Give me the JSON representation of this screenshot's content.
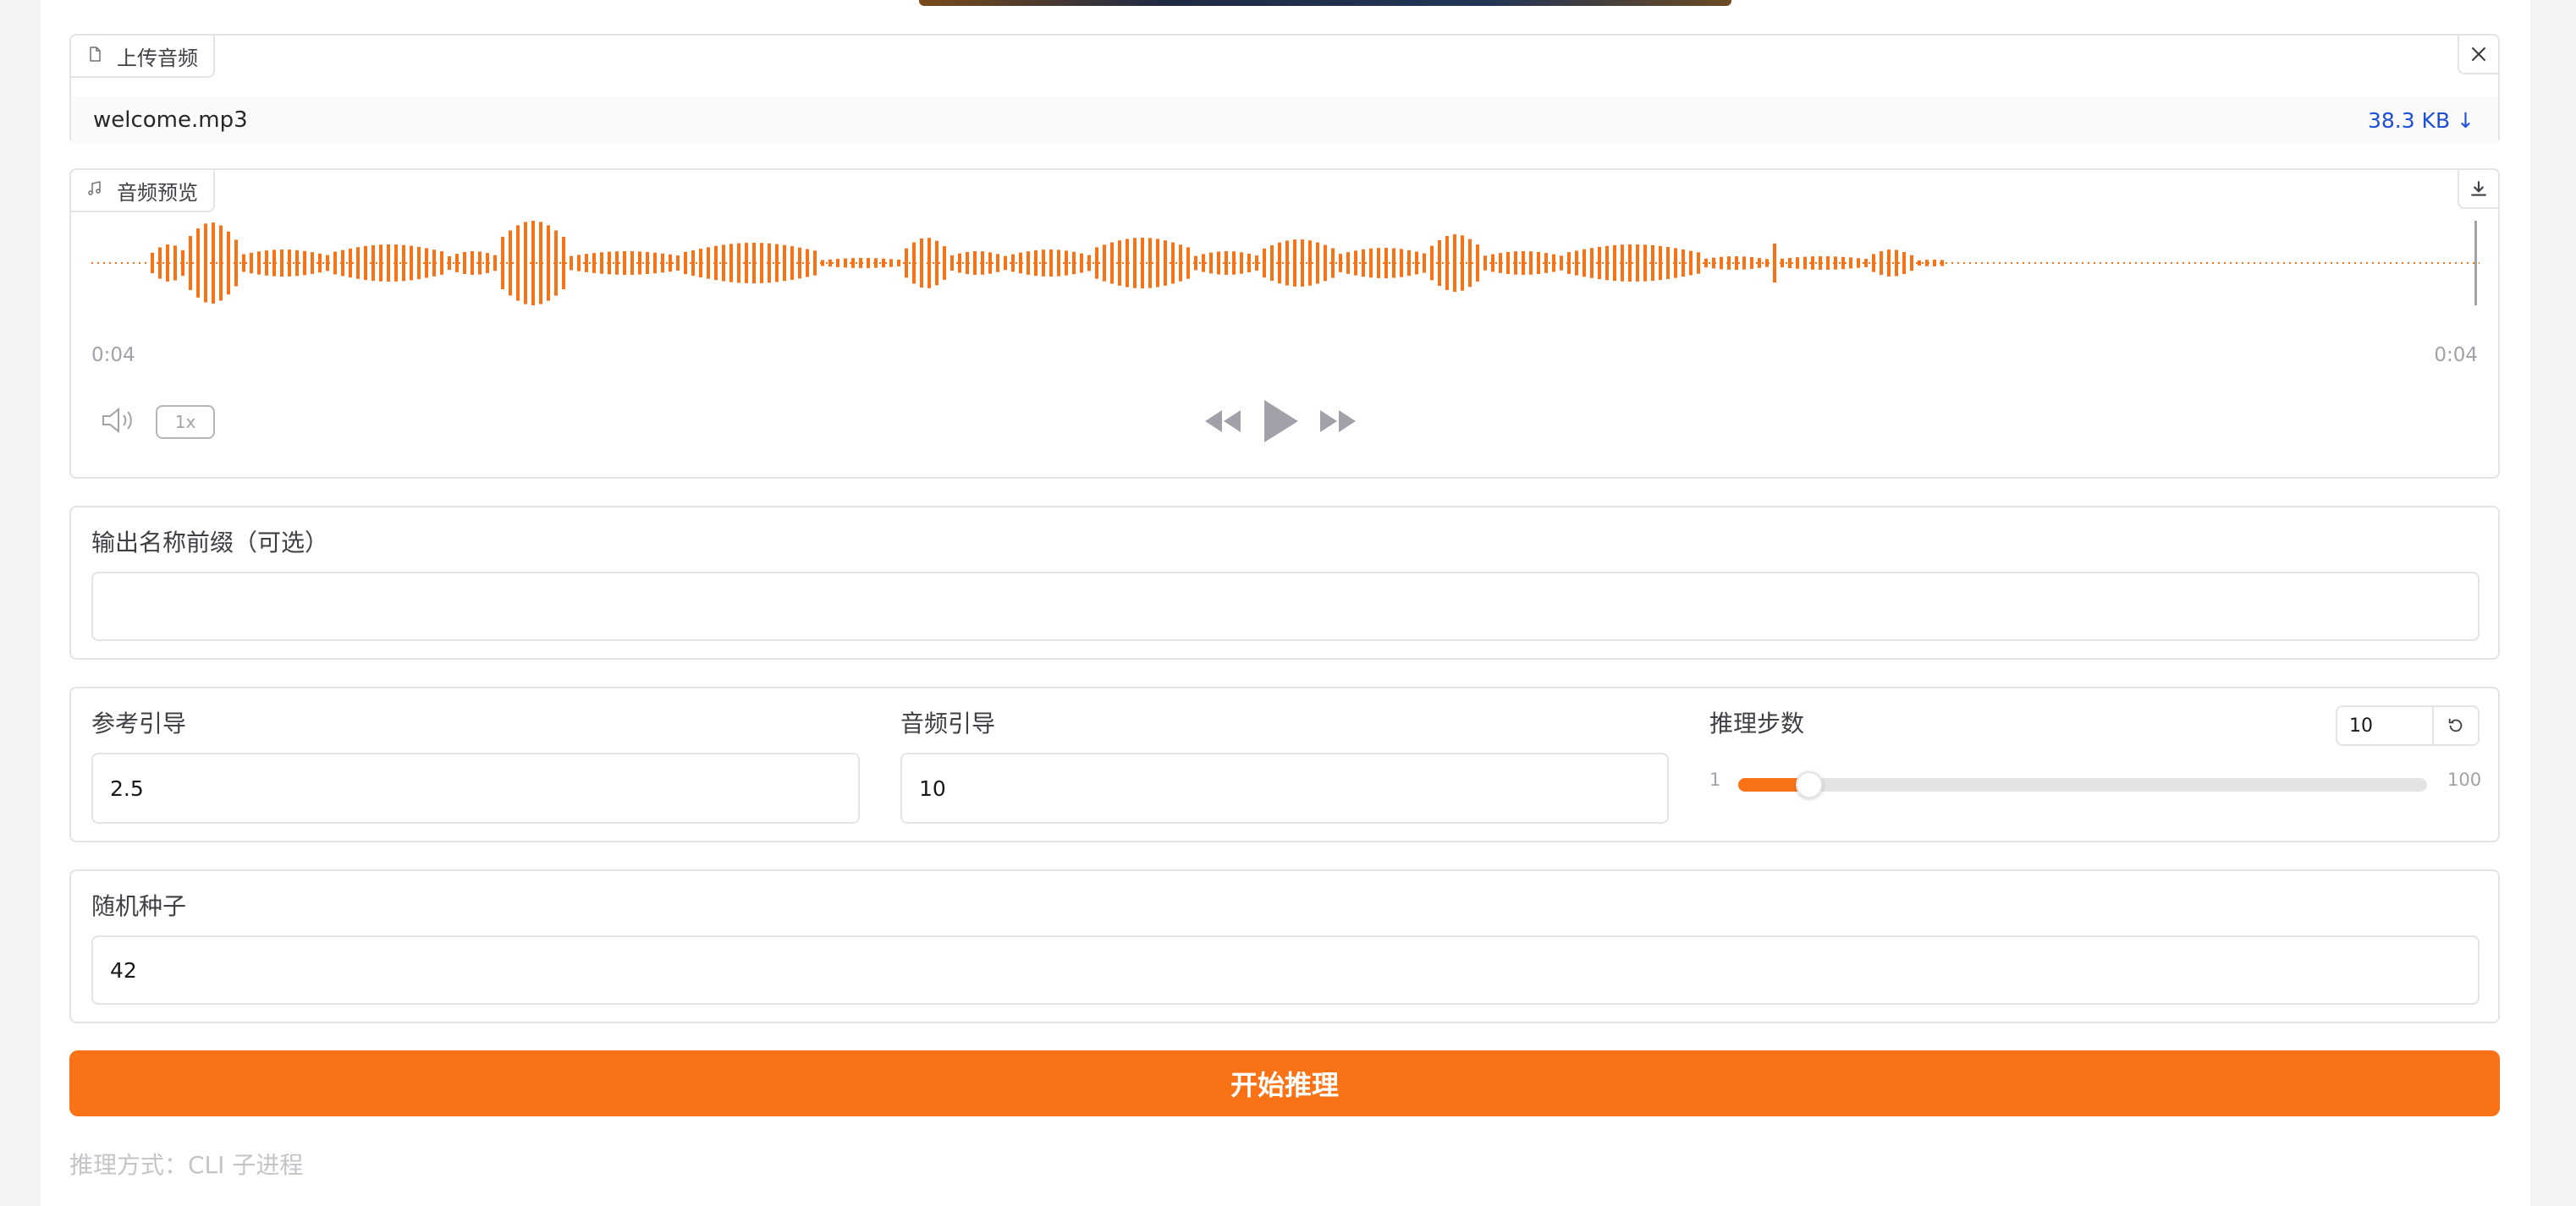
{
  "upload": {
    "label": "上传音频",
    "file_name": "welcome.mp3",
    "file_size": "38.3 KB ↓"
  },
  "preview": {
    "label": "音频预览",
    "time_current": "0:04",
    "time_total": "0:04",
    "speed": "1x",
    "wave_color": "#f97316"
  },
  "prefix": {
    "label": "输出名称前缀（可选）",
    "value": ""
  },
  "params": {
    "ref_guidance": {
      "label": "参考引导",
      "value": "2.5"
    },
    "audio_guidance": {
      "label": "音频引导",
      "value": "10"
    },
    "steps": {
      "label": "推理步数",
      "value": "10",
      "min": "1",
      "max": "100",
      "fraction": 0.091
    }
  },
  "seed": {
    "label": "随机种子",
    "value": "42"
  },
  "run_button": "开始推理",
  "footer_note": "推理方式：CLI 子进程",
  "colors": {
    "accent": "#f97316",
    "link": "#1d4ed8"
  }
}
